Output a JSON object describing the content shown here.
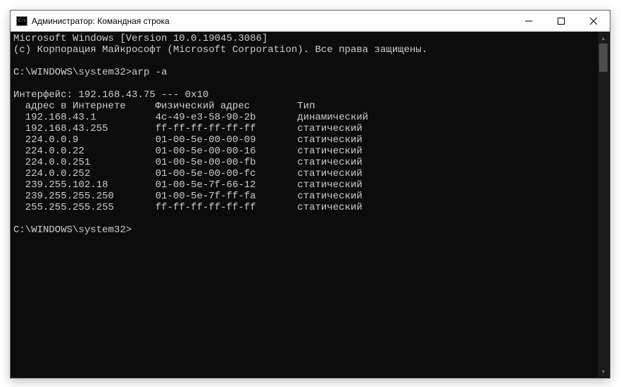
{
  "window": {
    "title": "Администратор: Командная строка"
  },
  "terminal": {
    "banner_line1": "Microsoft Windows [Version 10.0.19045.3086]",
    "banner_line2": "(c) Корпорация Майкрософт (Microsoft Corporation). Все права защищены.",
    "prompt1_path": "C:\\WINDOWS\\system32>",
    "prompt1_cmd": "arp -a",
    "interface_line": "Интерфейс: 192.168.43.75 --- 0x10",
    "header_col1": "адрес в Интернете",
    "header_col2": "Физический адрес",
    "header_col3": "Тип",
    "rows": [
      {
        "ip": "192.168.43.1",
        "mac": "4c-49-e3-58-90-2b",
        "type": "динамический"
      },
      {
        "ip": "192.168.43.255",
        "mac": "ff-ff-ff-ff-ff-ff",
        "type": "статический"
      },
      {
        "ip": "224.0.0.9",
        "mac": "01-00-5e-00-00-09",
        "type": "статический"
      },
      {
        "ip": "224.0.0.22",
        "mac": "01-00-5e-00-00-16",
        "type": "статический"
      },
      {
        "ip": "224.0.0.251",
        "mac": "01-00-5e-00-00-fb",
        "type": "статический"
      },
      {
        "ip": "224.0.0.252",
        "mac": "01-00-5e-00-00-fc",
        "type": "статический"
      },
      {
        "ip": "239.255.102.18",
        "mac": "01-00-5e-7f-66-12",
        "type": "статический"
      },
      {
        "ip": "239.255.255.250",
        "mac": "01-00-5e-7f-ff-fa",
        "type": "статический"
      },
      {
        "ip": "255.255.255.255",
        "mac": "ff-ff-ff-ff-ff-ff",
        "type": "статический"
      }
    ],
    "prompt2_path": "C:\\WINDOWS\\system32>",
    "col_widths": {
      "ip": 22,
      "mac": 22,
      "type": 0,
      "ip_indent": 2,
      "header_indent": 2
    }
  }
}
